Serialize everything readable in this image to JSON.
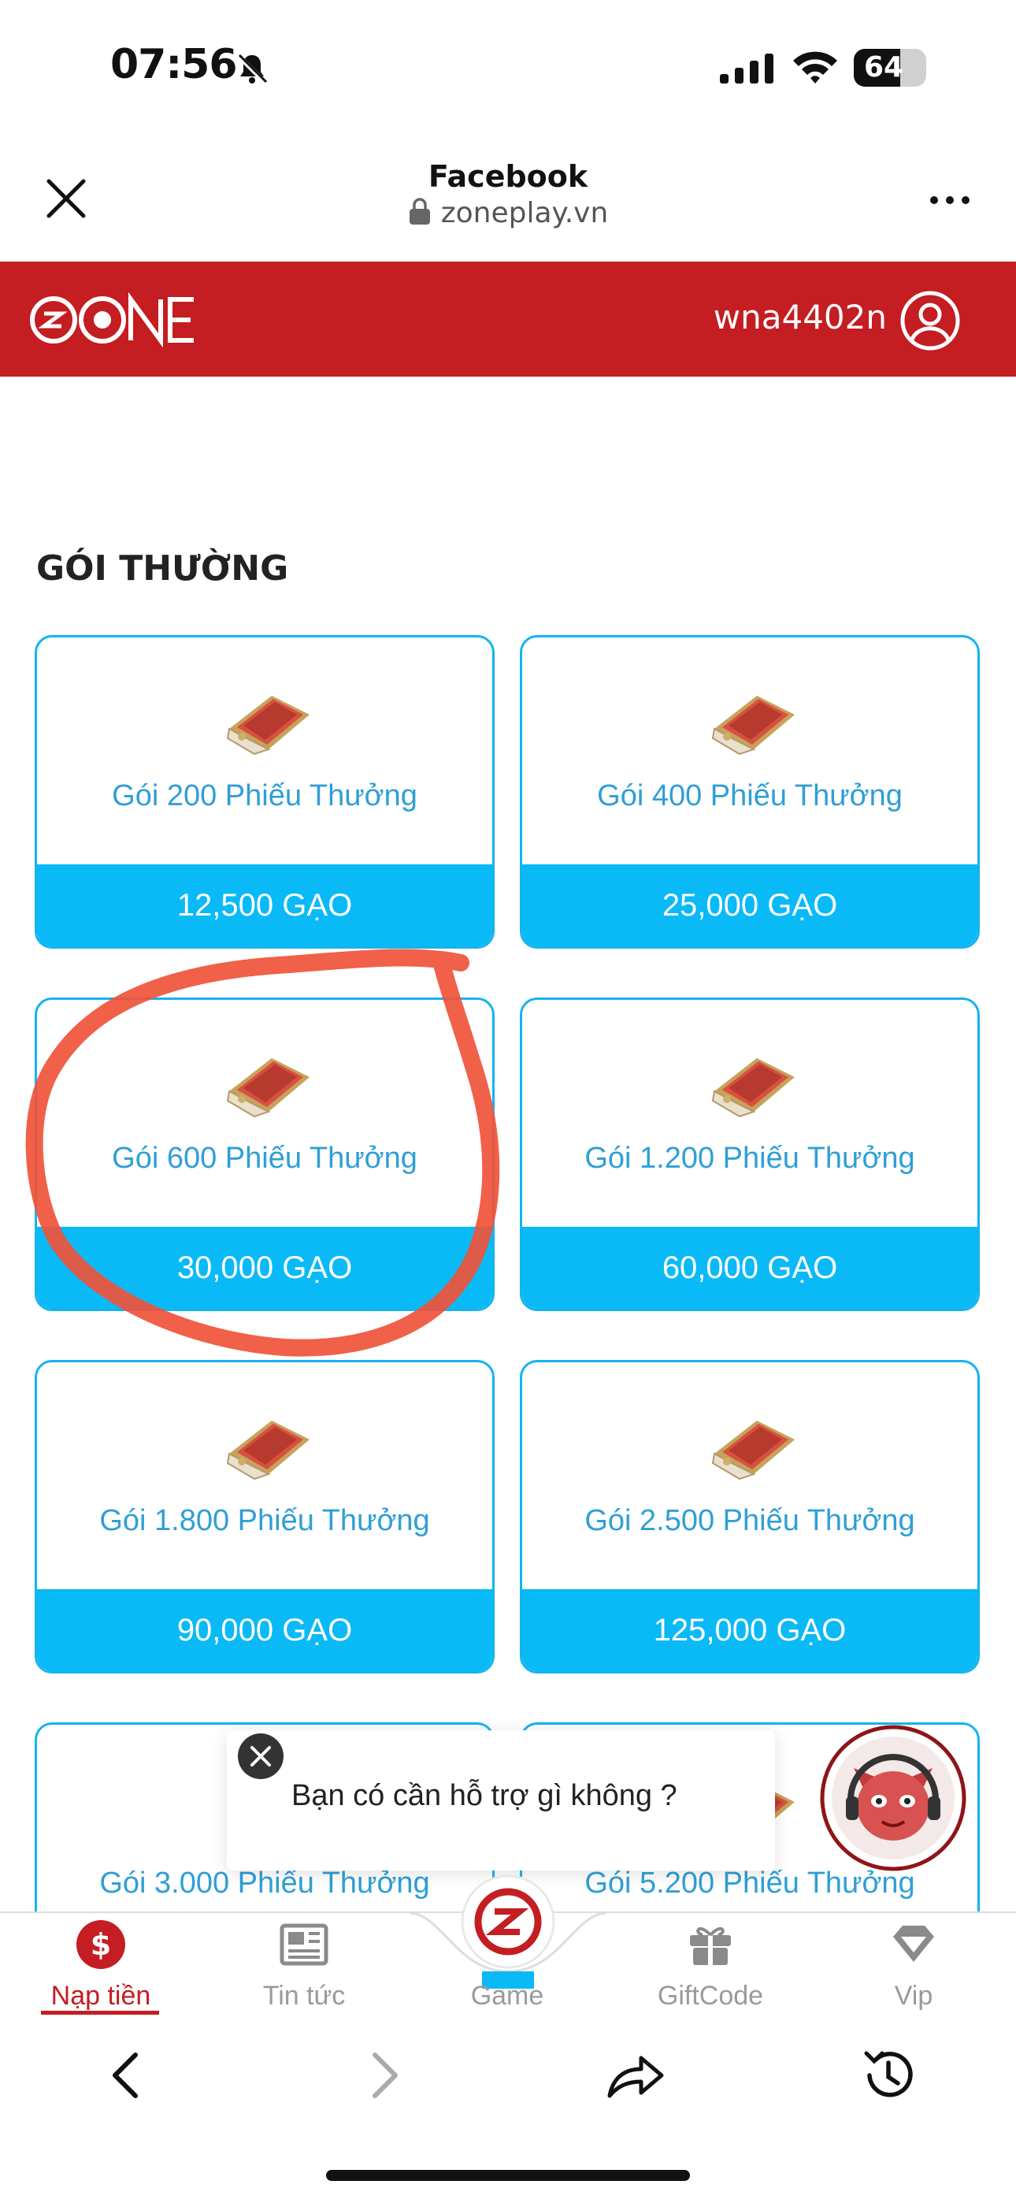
{
  "status_bar": {
    "time": "07:56",
    "battery": "64",
    "battery_level": 0.64,
    "icons": [
      "bell-slash-icon",
      "signal-icon",
      "wifi-icon",
      "battery-icon"
    ]
  },
  "browser": {
    "title": "Facebook",
    "url": "zoneplay.vn",
    "icons": [
      "close-icon",
      "lock-icon",
      "more-icon"
    ]
  },
  "site_header": {
    "username": "wna4402n",
    "colors": {
      "header": "#c41d22"
    }
  },
  "section": {
    "title": "GÓI THƯỜNG"
  },
  "packages": [
    {
      "title": "Gói 200 Phiếu Thưởng",
      "price": "12,500 GẠO"
    },
    {
      "title": "Gói 400 Phiếu Thưởng",
      "price": "25,000 GẠO"
    },
    {
      "title": "Gói 600 Phiếu Thưởng",
      "price": "30,000 GẠO"
    },
    {
      "title": "Gói 1.200 Phiếu Thưởng",
      "price": "60,000 GẠO"
    },
    {
      "title": "Gói 1.800 Phiếu Thưởng",
      "price": "90,000 GẠO"
    },
    {
      "title": "Gói 2.500 Phiếu Thưởng",
      "price": "125,000 GẠO"
    },
    {
      "title": "Gói 3.000 Phiếu Thưởng",
      "price": ""
    },
    {
      "title": "Gói 5.200 Phiếu Thưởng",
      "price": ""
    }
  ],
  "chat": {
    "message": "Bạn có cần hỗ trợ gì không ?"
  },
  "tabs": [
    {
      "label": "Nạp tiền",
      "icon": "dollar-icon",
      "active": true
    },
    {
      "label": "Tin tức",
      "icon": "news-icon",
      "active": false
    },
    {
      "label": "Game",
      "icon": "zone-logo-icon",
      "active": false
    },
    {
      "label": "GiftCode",
      "icon": "gift-icon",
      "active": false
    },
    {
      "label": "Vip",
      "icon": "diamond-icon",
      "active": false
    }
  ],
  "toolbar": {
    "icons": [
      "back-icon",
      "forward-icon",
      "share-icon",
      "history-icon"
    ]
  },
  "colors": {
    "accent_red": "#c41d22",
    "card_blue": "#09baf7",
    "title_blue": "#2f9fd6",
    "annotation": "#f0533a"
  }
}
